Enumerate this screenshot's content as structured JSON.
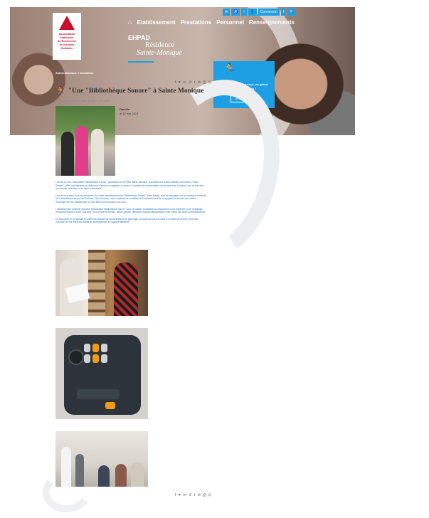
{
  "topbar": {
    "items": [
      "✉",
      "♿",
      "i",
      "👤",
      "Connexion",
      "f",
      "🔍"
    ]
  },
  "logo": {
    "lines": [
      "Association",
      "Nationale",
      "de Recherche",
      "et d'Action",
      "Solidaire"
    ]
  },
  "nav": {
    "items": [
      "Etablissement",
      "Prestations",
      "Personnel",
      "Renseignements"
    ]
  },
  "hero": {
    "type": "EHPAD",
    "line2": "Résidence",
    "line3": "Sainte-Monique",
    "breadcrumb": "Sainte-Monique  >  Actualités"
  },
  "promo": {
    "text": "Un petit geste pour vous, un grand geste pour nous !",
    "button": "Je fais un don"
  },
  "article": {
    "share_icons": "f ♥ in ✆ t ✉ ⎙ ⊡",
    "title": "\"Une \"Bibliothèque Sonore\" à Sainte Monique",
    "published": "Publié le 14 juin 2023 - Mis à jour le 14 juin 2023",
    "author_name": "Danièle",
    "author_date": "le 12 mai 2023",
    "paragraphs": [
      "Le lundi 15 mai, l'association \"Bibliothèque Sonore\", partenaire de l'EHPAD Sainte Monique, a procédé à la remise officielle d'un lecteur \"Victor Stream\". Offert aux résidents en déficience visuelle ou cognitive, ce lecteur a vocation de leur permettre de renouer avec la lecture, que ce soit dans une activité collective ou de façon individuelle.",
      "Lors de ce rendez-vous, la présidente du comité départemental des \"Bibliothèque Sonore\", Mme Maillot, était accompagnée de la secrétaire bénévole de la bibliothèque sonore de Toulouse, Mme Moureau, qui a expliqué les modalités de fonctionnement de cet appareil et d'accès aux milliers d'ouvrages de leur bibliothèque (20 000 titres sont proposés à ce jour).",
      "L'établissement remercie vivement l'association \"Bibliothèque Sonore\" pour ce cadeau s'adaptant aux aspirations d'une résidente ou de l'équipage, précisément dans le loisir \"sud-livre\" de tout type de format : roman policier, littérature, essais philosophiques voire même des livres conversationnels.",
      "En avant-soft, en proposant en partie les déficiences sensorielles à leur grand âge, contribuons une fois dans le moment de la sorte l'ouverture culturelle de nos résidents avides de divertissement et voyages littéraires !"
    ]
  }
}
